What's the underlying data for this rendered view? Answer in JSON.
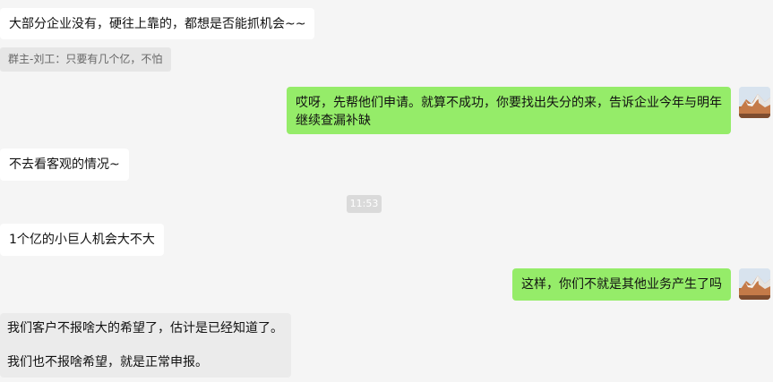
{
  "messages": {
    "top_message": "大部分企业没有，硬往上靠的，都想是否能抓机会~~",
    "quote_text": "群主-刘工：只要有几个亿，不怕",
    "outgoing_1": {
      "line1": "哎呀，先帮他们申请。就算不成功，你要找出失分的来，告诉企业今年与明年",
      "line2": "继续查漏补缺"
    },
    "incoming_2": "不去看客观的情况~",
    "timestamp": "11:53",
    "incoming_3": "1个亿的小巨人机会大不大",
    "outgoing_2": "这样，你们不就是其他业务产生了吗",
    "incoming_4": {
      "line1": "我们客户不报啥大的希望了，估计是已经知道了。",
      "line2": "我们也不报啥希望，就是正常申报。"
    }
  },
  "icons": {
    "avatar": "mountain-avatar"
  },
  "colors": {
    "background": "#f5f5f5",
    "incoming_bubble": "#ffffff",
    "outgoing_bubble": "#95ec69",
    "quote_background": "#e6e6e6",
    "timestamp_background": "#dadada"
  }
}
